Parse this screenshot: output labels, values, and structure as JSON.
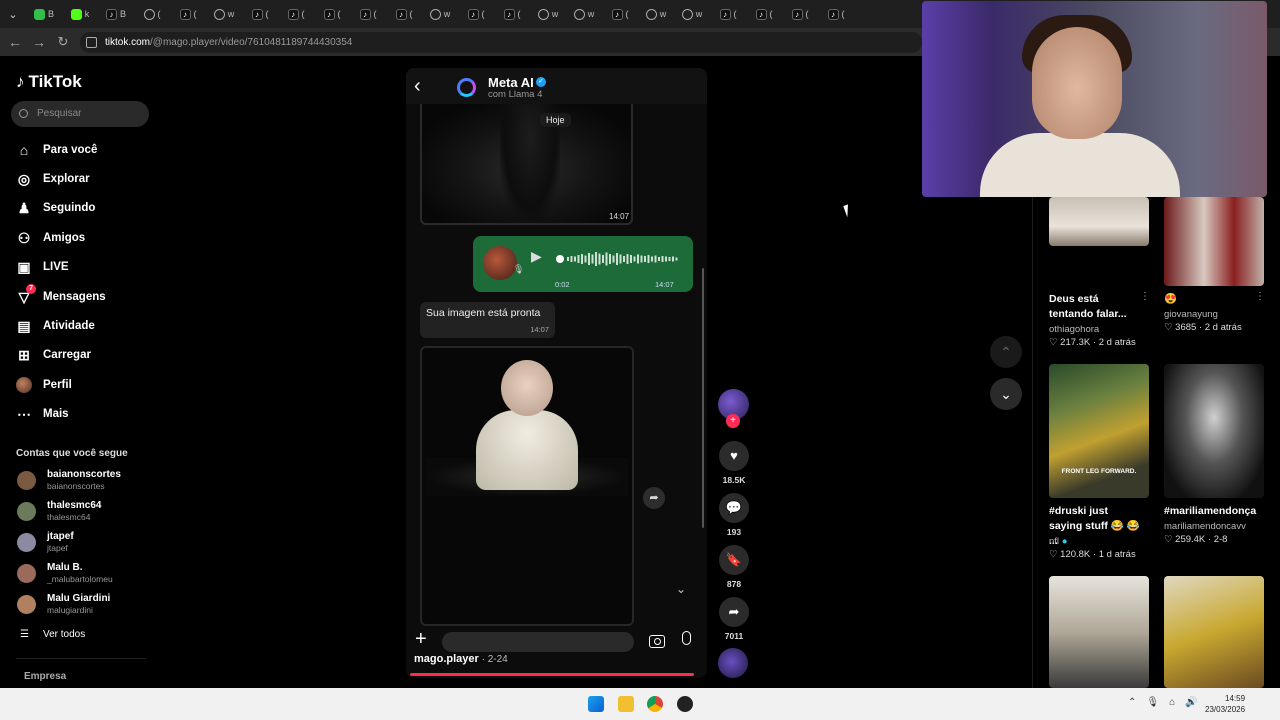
{
  "browser": {
    "tabs": [
      {
        "icon": "whatsapp",
        "label": "B"
      },
      {
        "icon": "kick",
        "label": "k"
      },
      {
        "icon": "tiktok",
        "label": "B"
      },
      {
        "icon": "web",
        "label": "("
      },
      {
        "icon": "tiktok",
        "label": "("
      },
      {
        "icon": "web",
        "label": "w"
      },
      {
        "icon": "tiktok",
        "label": "("
      },
      {
        "icon": "tiktok",
        "label": "("
      },
      {
        "icon": "tiktok",
        "label": "("
      },
      {
        "icon": "tiktok",
        "label": "("
      },
      {
        "icon": "tiktok",
        "label": "("
      },
      {
        "icon": "web",
        "label": "w"
      },
      {
        "icon": "tiktok",
        "label": "("
      },
      {
        "icon": "tiktok",
        "label": "("
      },
      {
        "icon": "web",
        "label": "w"
      },
      {
        "icon": "web",
        "label": "w"
      },
      {
        "icon": "tiktok",
        "label": "("
      },
      {
        "icon": "web",
        "label": "w"
      },
      {
        "icon": "web",
        "label": "w"
      },
      {
        "icon": "tiktok",
        "label": "("
      },
      {
        "icon": "tiktok",
        "label": "("
      },
      {
        "icon": "tiktok",
        "label": "("
      },
      {
        "icon": "tiktok",
        "label": "("
      }
    ],
    "url_domain": "tiktok.com",
    "url_path": "/@mago.player/video/7610481189744430354"
  },
  "sidebar": {
    "logo": "TikTok",
    "search_placeholder": "Pesquisar",
    "nav": [
      {
        "label": "Para você",
        "icon": "home-icon"
      },
      {
        "label": "Explorar",
        "icon": "compass-icon"
      },
      {
        "label": "Seguindo",
        "icon": "following-icon"
      },
      {
        "label": "Amigos",
        "icon": "friends-icon"
      },
      {
        "label": "LIVE",
        "icon": "live-icon"
      },
      {
        "label": "Mensagens",
        "icon": "messages-icon",
        "badge": "7"
      },
      {
        "label": "Atividade",
        "icon": "activity-icon"
      },
      {
        "label": "Carregar",
        "icon": "upload-icon"
      },
      {
        "label": "Perfil",
        "icon": "profile-avatar"
      },
      {
        "label": "Mais",
        "icon": "more-icon"
      }
    ],
    "following_title": "Contas que você segue",
    "accounts": [
      {
        "name": "baianonscortes",
        "handle": "baianonscortes"
      },
      {
        "name": "thalesmc64",
        "handle": "thalesmc64"
      },
      {
        "name": "jtapef",
        "handle": "jtapef"
      },
      {
        "name": "Malu B.",
        "handle": "_malubartolomeu"
      },
      {
        "name": "Malu Giardini",
        "handle": "malugiardini"
      }
    ],
    "see_all": "Ver todos",
    "company": "Empresa"
  },
  "video": {
    "chat_name": "Meta AI",
    "chat_sub": "com Llama 4",
    "today_label": "Hoje",
    "img1_time": "14:07",
    "audio_length": "0:02",
    "audio_time": "14:07",
    "message_text": "Sua imagem está pronta",
    "message_time": "14:07",
    "author": "mago.player",
    "date": " · 2-24",
    "progress_fraction": 0.97
  },
  "actions": {
    "likes": "18.5K",
    "comments": "193",
    "saves": "878",
    "shares": "7011"
  },
  "recommendations": [
    {
      "title": "Deus está tentando falar...",
      "user": "othiagohora",
      "likes": "217.3K",
      "age": "2 d atrás"
    },
    {
      "title": "😍",
      "user": "giovanayung",
      "likes": "3685",
      "age": "2 d atrás"
    },
    {
      "title": "#druski just saying stuff 😂 😂 ...",
      "user": "nfl",
      "likes": "120.8K",
      "age": "1 d atrás"
    },
    {
      "title": "#mariliamendonça",
      "user": "mariliamendoncavv",
      "likes": "259.4K",
      "age": "2-8"
    }
  ],
  "thumb_texts": {
    "druski": "FRONT LEG FORWARD."
  },
  "taskbar": {
    "time": "14:59",
    "date": "23/03/2026"
  }
}
